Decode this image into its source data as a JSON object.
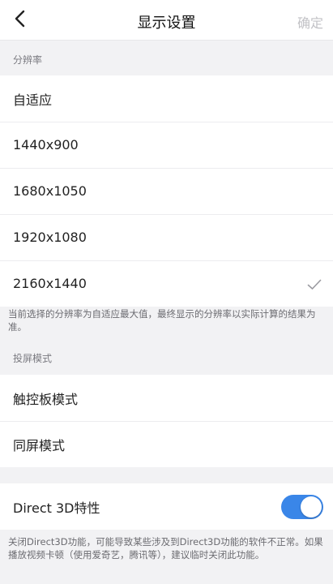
{
  "header": {
    "title": "显示设置",
    "confirm_label": "确定"
  },
  "resolution": {
    "section_label": "分辨率",
    "options": [
      "自适应",
      "1440x900",
      "1680x1050",
      "1920x1080",
      "2160x1440"
    ],
    "selected": "2160x1440",
    "note": "当前选择的分辨率为自适应最大值，最终显示的分辨率以实际计算的结果为准。"
  },
  "projection": {
    "section_label": "投屏模式",
    "options": [
      "触控板模式",
      "同屏模式"
    ]
  },
  "direct3d": {
    "label": "Direct 3D特性",
    "enabled": true,
    "note": "关闭Direct3D功能，可能导致某些涉及到Direct3D功能的软件不正常。如果播放视频卡顿（使用爱奇艺，腾讯等），建议临时关闭此功能。"
  },
  "colors": {
    "accent": "#3a86e8",
    "check": "#9a9aa0",
    "disabled_text": "#c2c2c6"
  },
  "icons": [
    "back-chevron-icon",
    "checkmark-icon"
  ]
}
